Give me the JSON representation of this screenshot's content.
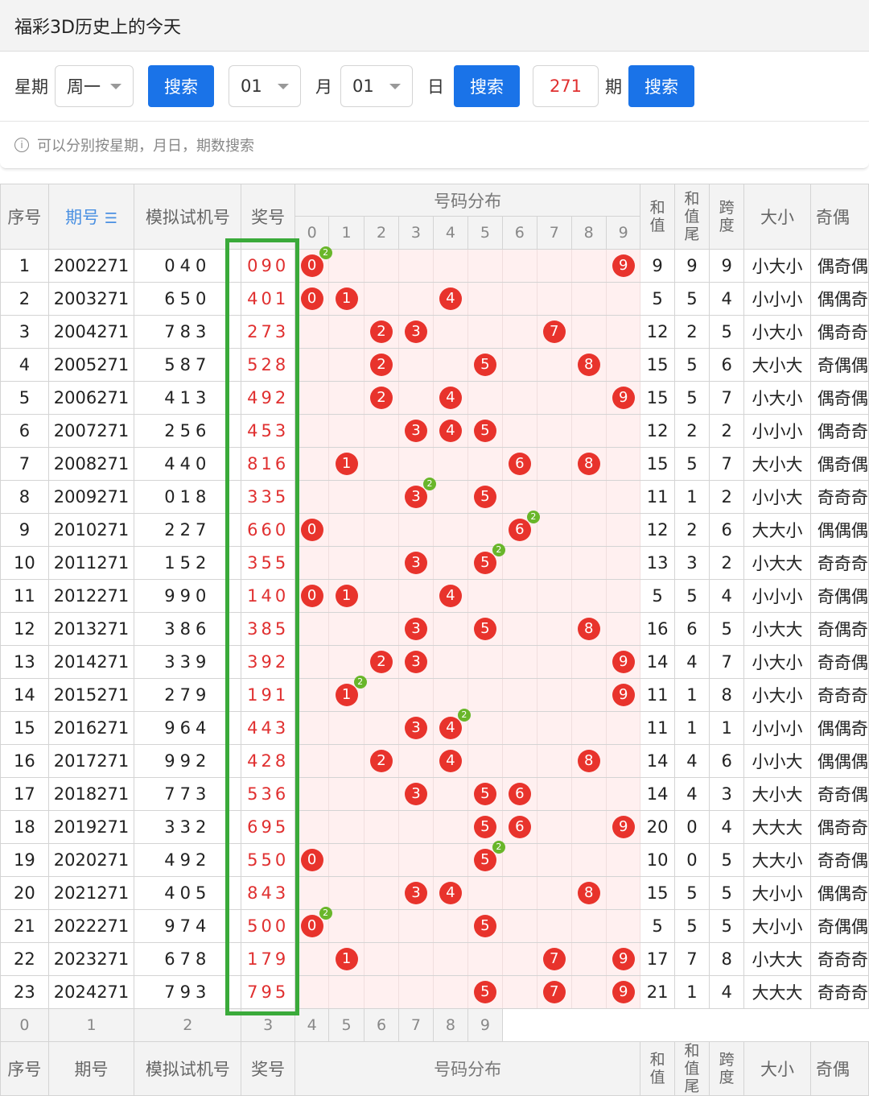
{
  "header": {
    "title": "福彩3D历史上的今天"
  },
  "search": {
    "week_label": "星期",
    "week_value": "周一",
    "search1": "搜索",
    "month_value": "01",
    "month_label": "月",
    "day_value": "01",
    "day_label": "日",
    "search2": "搜索",
    "period_value": "271",
    "period_label": "期",
    "search3": "搜索",
    "tip": "可以分别按星期，月日，期数搜索"
  },
  "table": {
    "headers": {
      "seq": "序号",
      "period": "期号",
      "sim": "模拟试机号",
      "prize": "奖号",
      "dist": "号码分布",
      "sum": "和值",
      "sum_tail": "和值尾",
      "span": "跨度",
      "size": "大小",
      "parity": "奇偶"
    },
    "digits": [
      "0",
      "1",
      "2",
      "3",
      "4",
      "5",
      "6",
      "7",
      "8",
      "9"
    ],
    "rows": [
      {
        "seq": "1",
        "period": "2002271",
        "sim": "040",
        "prize": "090",
        "sum": "9",
        "tail": "9",
        "span": "9",
        "size": "小大小",
        "parity": "偶奇偶"
      },
      {
        "seq": "2",
        "period": "2003271",
        "sim": "650",
        "prize": "401",
        "sum": "5",
        "tail": "5",
        "span": "4",
        "size": "小小小",
        "parity": "偶偶奇"
      },
      {
        "seq": "3",
        "period": "2004271",
        "sim": "783",
        "prize": "273",
        "sum": "12",
        "tail": "2",
        "span": "5",
        "size": "小大小",
        "parity": "偶奇奇"
      },
      {
        "seq": "4",
        "period": "2005271",
        "sim": "587",
        "prize": "528",
        "sum": "15",
        "tail": "5",
        "span": "6",
        "size": "大小大",
        "parity": "奇偶偶"
      },
      {
        "seq": "5",
        "period": "2006271",
        "sim": "413",
        "prize": "492",
        "sum": "15",
        "tail": "5",
        "span": "7",
        "size": "小大小",
        "parity": "偶奇偶"
      },
      {
        "seq": "6",
        "period": "2007271",
        "sim": "256",
        "prize": "453",
        "sum": "12",
        "tail": "2",
        "span": "2",
        "size": "小小小",
        "parity": "偶奇奇"
      },
      {
        "seq": "7",
        "period": "2008271",
        "sim": "440",
        "prize": "816",
        "sum": "15",
        "tail": "5",
        "span": "7",
        "size": "大小大",
        "parity": "偶奇偶"
      },
      {
        "seq": "8",
        "period": "2009271",
        "sim": "018",
        "prize": "335",
        "sum": "11",
        "tail": "1",
        "span": "2",
        "size": "小小大",
        "parity": "奇奇奇"
      },
      {
        "seq": "9",
        "period": "2010271",
        "sim": "227",
        "prize": "660",
        "sum": "12",
        "tail": "2",
        "span": "6",
        "size": "大大小",
        "parity": "偶偶偶"
      },
      {
        "seq": "10",
        "period": "2011271",
        "sim": "152",
        "prize": "355",
        "sum": "13",
        "tail": "3",
        "span": "2",
        "size": "小大大",
        "parity": "奇奇奇"
      },
      {
        "seq": "11",
        "period": "2012271",
        "sim": "990",
        "prize": "140",
        "sum": "5",
        "tail": "5",
        "span": "4",
        "size": "小小小",
        "parity": "奇偶偶"
      },
      {
        "seq": "12",
        "period": "2013271",
        "sim": "386",
        "prize": "385",
        "sum": "16",
        "tail": "6",
        "span": "5",
        "size": "小大大",
        "parity": "奇偶奇"
      },
      {
        "seq": "13",
        "period": "2014271",
        "sim": "339",
        "prize": "392",
        "sum": "14",
        "tail": "4",
        "span": "7",
        "size": "小大小",
        "parity": "奇奇偶"
      },
      {
        "seq": "14",
        "period": "2015271",
        "sim": "279",
        "prize": "191",
        "sum": "11",
        "tail": "1",
        "span": "8",
        "size": "小大小",
        "parity": "奇奇奇"
      },
      {
        "seq": "15",
        "period": "2016271",
        "sim": "964",
        "prize": "443",
        "sum": "11",
        "tail": "1",
        "span": "1",
        "size": "小小小",
        "parity": "偶偶奇"
      },
      {
        "seq": "16",
        "period": "2017271",
        "sim": "992",
        "prize": "428",
        "sum": "14",
        "tail": "4",
        "span": "6",
        "size": "小小大",
        "parity": "偶偶偶"
      },
      {
        "seq": "17",
        "period": "2018271",
        "sim": "773",
        "prize": "536",
        "sum": "14",
        "tail": "4",
        "span": "3",
        "size": "大小大",
        "parity": "奇奇偶"
      },
      {
        "seq": "18",
        "period": "2019271",
        "sim": "332",
        "prize": "695",
        "sum": "20",
        "tail": "0",
        "span": "4",
        "size": "大大大",
        "parity": "偶奇奇"
      },
      {
        "seq": "19",
        "period": "2020271",
        "sim": "492",
        "prize": "550",
        "sum": "10",
        "tail": "0",
        "span": "5",
        "size": "大大小",
        "parity": "奇奇偶"
      },
      {
        "seq": "20",
        "period": "2021271",
        "sim": "405",
        "prize": "843",
        "sum": "15",
        "tail": "5",
        "span": "5",
        "size": "大小小",
        "parity": "偶偶奇"
      },
      {
        "seq": "21",
        "period": "2022271",
        "sim": "974",
        "prize": "500",
        "sum": "5",
        "tail": "5",
        "span": "5",
        "size": "大小小",
        "parity": "奇偶偶"
      },
      {
        "seq": "22",
        "period": "2023271",
        "sim": "678",
        "prize": "179",
        "sum": "17",
        "tail": "7",
        "span": "8",
        "size": "小大大",
        "parity": "奇奇奇"
      },
      {
        "seq": "23",
        "period": "2024271",
        "sim": "793",
        "prize": "795",
        "sum": "21",
        "tail": "1",
        "span": "4",
        "size": "大大大",
        "parity": "奇奇奇"
      }
    ]
  },
  "colors": {
    "ball": "#e8332c",
    "dup_badge": "#69b62a",
    "highlight_box": "#3aaa3a",
    "button": "#1a73e8"
  }
}
